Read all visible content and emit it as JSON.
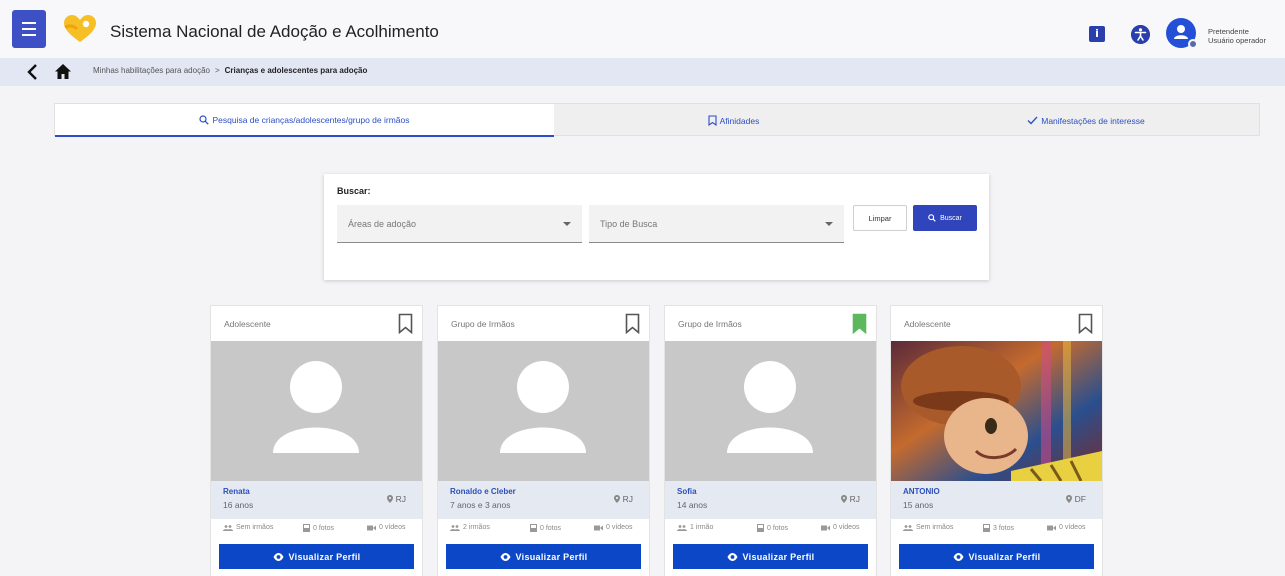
{
  "header": {
    "app_title": "Sistema Nacional de Adoção e Acolhimento",
    "info_icon_label": "i",
    "user_role_line1": "Pretendente",
    "user_role_line2": "Usuário operador"
  },
  "breadcrumb": {
    "item1": "Minhas habilitações para adoção",
    "separator": ">",
    "current": "Crianças e adolescentes para adoção"
  },
  "tabs": [
    {
      "label": "Pesquisa de crianças/adolescentes/grupo de irmãos",
      "icon": "search-icon",
      "active": true
    },
    {
      "label": "Afinidades",
      "icon": "bookmark-icon",
      "active": false
    },
    {
      "label": "Manifestações de interesse",
      "icon": "check-icon",
      "active": false
    }
  ],
  "search": {
    "title": "Buscar:",
    "areas_label": "Áreas de adoção",
    "tipo_label": "Tipo de Busca",
    "clear_label": "Limpar",
    "search_label": "Buscar"
  },
  "cards": [
    {
      "type": "Adolescente",
      "name": "Renata",
      "age": "16 anos",
      "location": "RJ",
      "siblings": "Sem irmãos",
      "photos": "0 fotos",
      "videos": "0 vídeos",
      "bookmarked": false,
      "has_photo": false,
      "button": "Visualizar Perfil"
    },
    {
      "type": "Grupo de Irmãos",
      "name": "Ronaldo e Cleber",
      "age": "7 anos e 3 anos",
      "location": "RJ",
      "siblings": "2 irmãos",
      "photos": "0 fotos",
      "videos": "0 vídeos",
      "bookmarked": false,
      "has_photo": false,
      "button": "Visualizar Perfil"
    },
    {
      "type": "Grupo de Irmãos",
      "name": "Sofia",
      "age": "14 anos",
      "location": "RJ",
      "siblings": "1 irmão",
      "photos": "0 fotos",
      "videos": "0 vídeos",
      "bookmarked": true,
      "has_photo": false,
      "button": "Visualizar Perfil"
    },
    {
      "type": "Adolescente",
      "name": "ANTONIO",
      "age": "15 anos",
      "location": "DF",
      "siblings": "Sem irmãos",
      "photos": "3 fotos",
      "videos": "0 vídeos",
      "bookmarked": false,
      "has_photo": true,
      "button": "Visualizar Perfil"
    }
  ],
  "colors": {
    "primary": "#0b47c7",
    "brand": "#3d50c6",
    "bookmark_active": "#5cb85c",
    "logo_yellow": "#f6bf26"
  }
}
